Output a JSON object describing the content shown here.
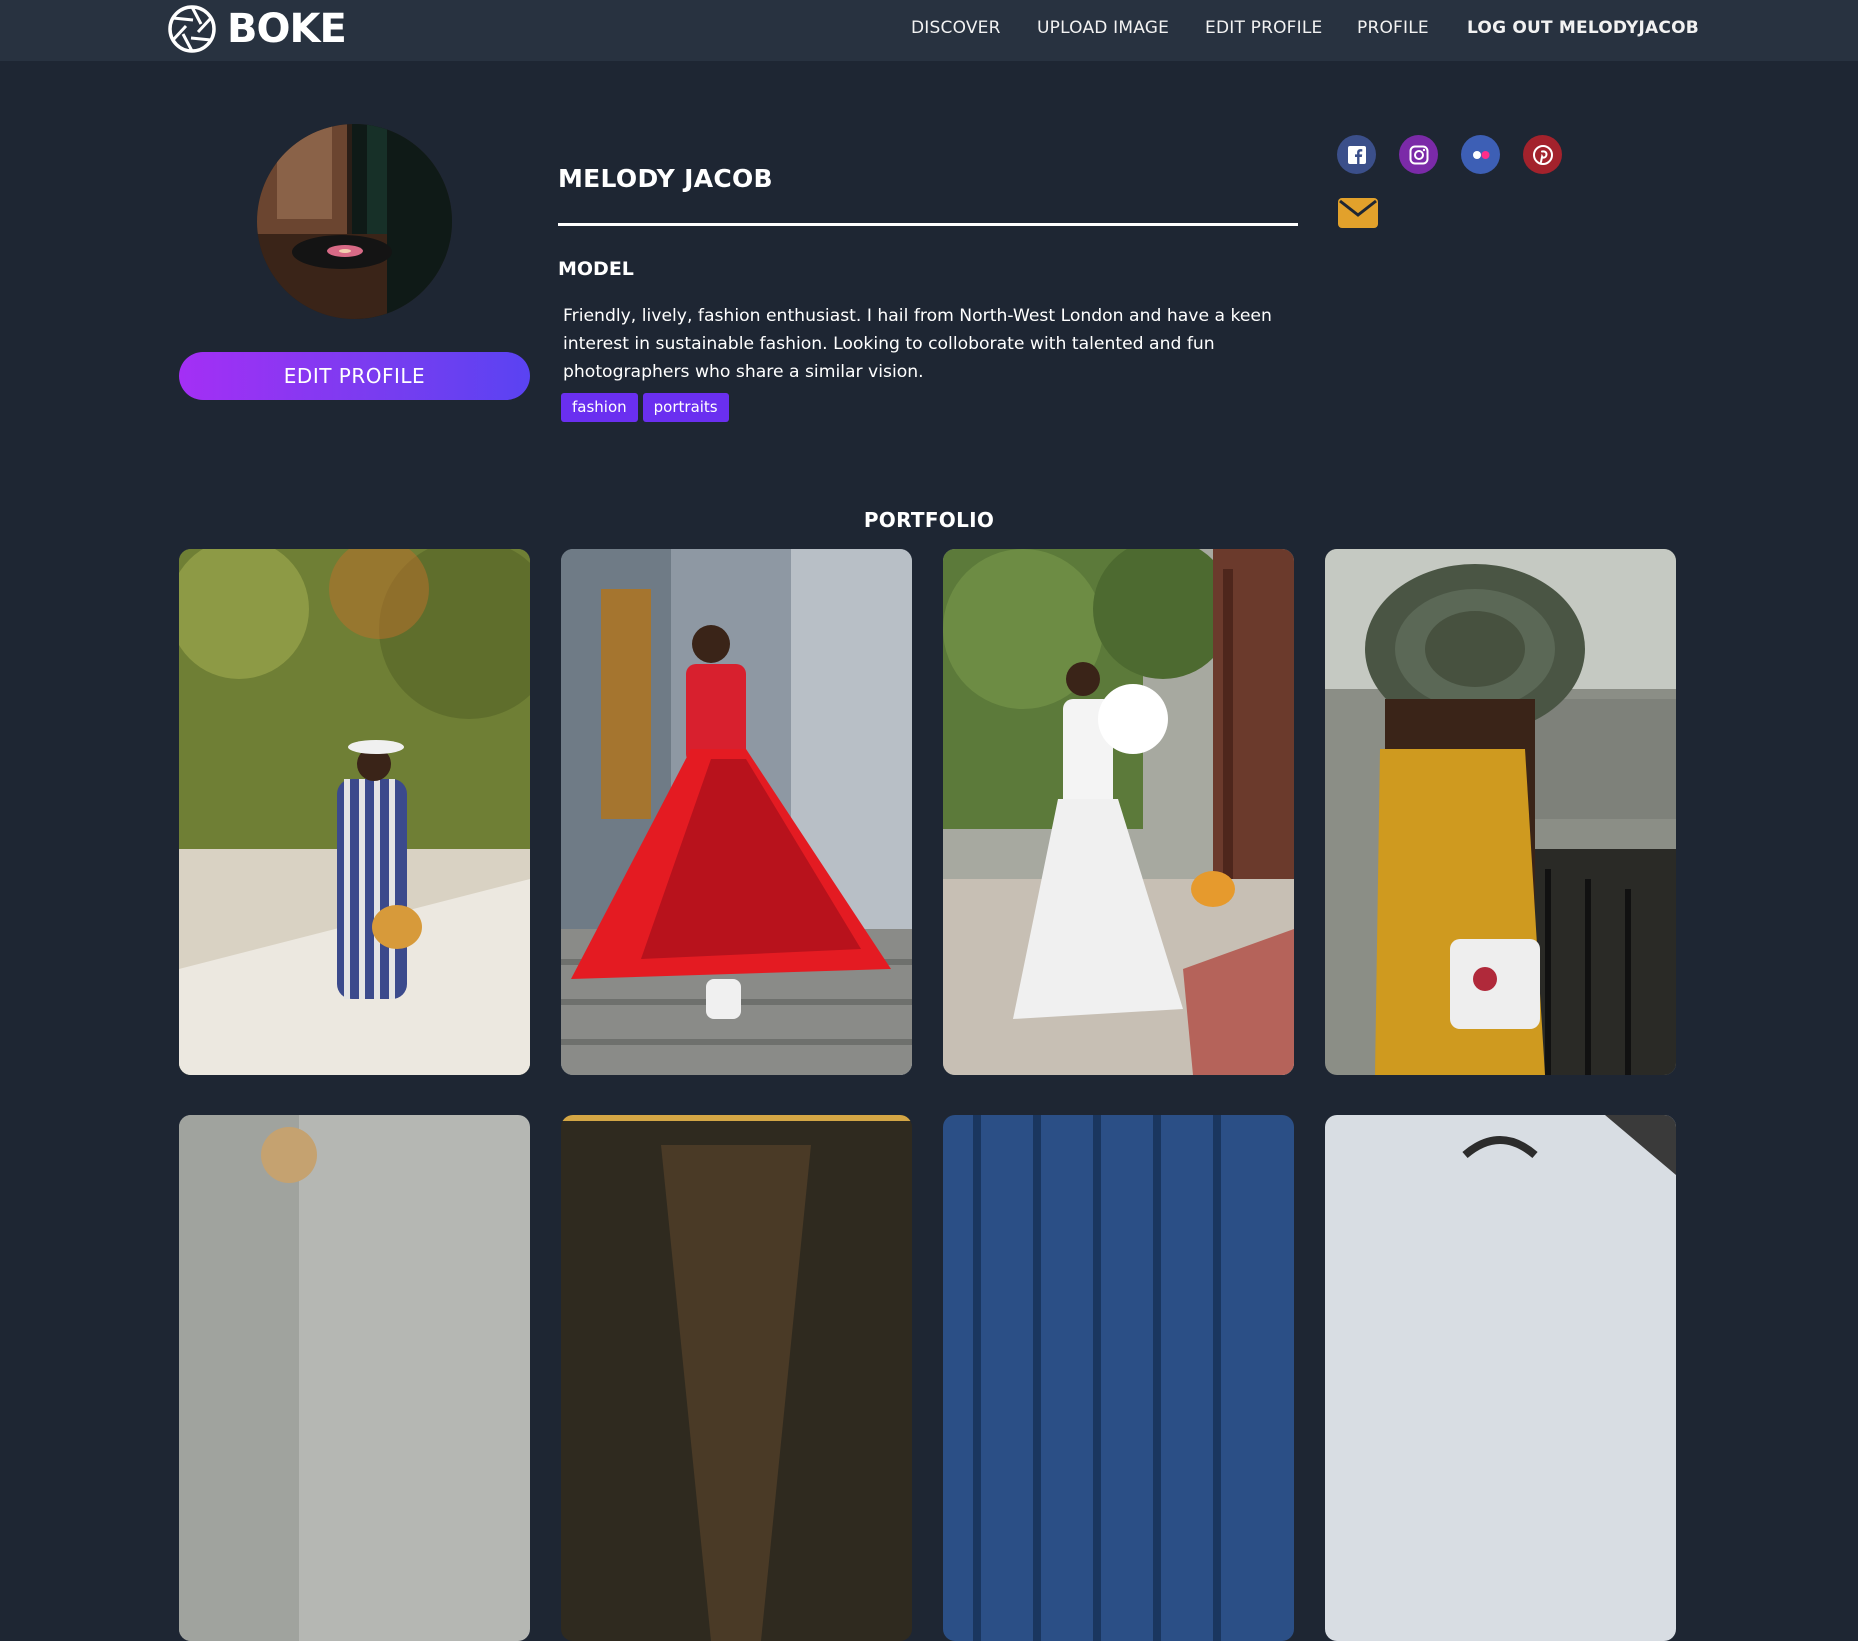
{
  "nav": {
    "brand": "BOKE",
    "links": [
      "DISCOVER",
      "UPLOAD IMAGE",
      "EDIT PROFILE",
      "PROFILE"
    ],
    "logout": "LOG OUT MELODYJACOB"
  },
  "profile": {
    "name": "MELODY JACOB",
    "role": "MODEL",
    "bio": "Friendly, lively, fashion enthusiast. I hail from North-West London and have a keen interest in sustainable fashion. Looking to colloborate with talented and fun photographers who share a similar vision.",
    "tags": [
      "fashion",
      "portraits"
    ],
    "edit_button": "EDIT PROFILE"
  },
  "social": [
    {
      "name": "facebook-icon",
      "color": "#3b5998"
    },
    {
      "name": "instagram-icon",
      "color": "#7b2aa8"
    },
    {
      "name": "flickr-icon",
      "color": "#3d5fb5"
    },
    {
      "name": "pinterest-icon",
      "color": "#a3222c"
    },
    {
      "name": "mail-icon",
      "color": "#e2a12b"
    }
  ],
  "portfolio": {
    "title": "PORTFOLIO"
  },
  "colors": {
    "background": "#1e2633",
    "navbar": "#283240",
    "accent_purple": "#6a2ff0",
    "button_gradient": [
      "#a42ff5",
      "#5a43f2"
    ]
  }
}
